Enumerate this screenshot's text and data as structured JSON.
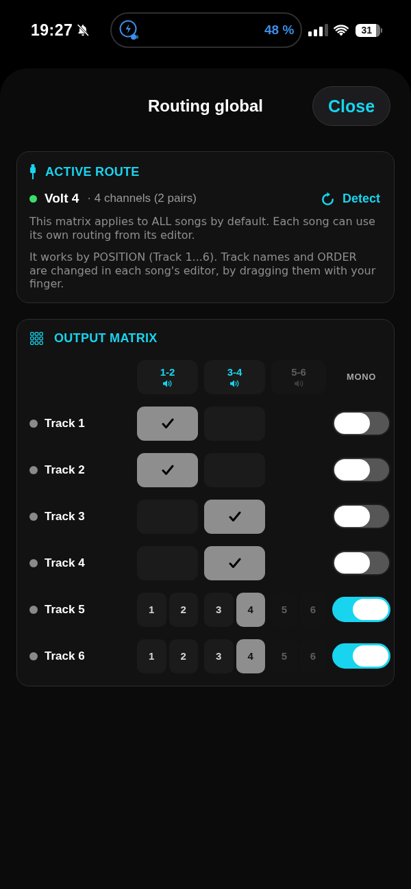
{
  "status_bar": {
    "time": "19:27",
    "charge_percent": "48 %",
    "battery": "31"
  },
  "sheet": {
    "title": "Routing global",
    "close_button": "Close"
  },
  "active_route": {
    "heading": "ACTIVE ROUTE",
    "device": {
      "name": "Volt 4",
      "detail": "· 4 channels (2 pairs)",
      "connected": true
    },
    "detect_button": "Detect",
    "paragraphs": [
      "This matrix applies to ALL songs by default. Each song can use its own routing from its editor.",
      "It works by POSITION (Track 1...6). Track names and ORDER are changed in each song's editor, by dragging them with your finger."
    ]
  },
  "output_matrix": {
    "heading": "OUTPUT MATRIX",
    "columns": [
      {
        "label": "1-2",
        "disabled": false
      },
      {
        "label": "3-4",
        "disabled": false
      },
      {
        "label": "5-6",
        "disabled": true
      }
    ],
    "mono_label": "MONO",
    "rows": [
      {
        "name": "Track 1",
        "kind": "pair",
        "pairs": [
          {
            "checked": true
          },
          {
            "checked": false
          }
        ],
        "mono": false
      },
      {
        "name": "Track 2",
        "kind": "pair",
        "pairs": [
          {
            "checked": true
          },
          {
            "checked": false
          }
        ],
        "mono": false
      },
      {
        "name": "Track 3",
        "kind": "pair",
        "pairs": [
          {
            "checked": false
          },
          {
            "checked": true
          }
        ],
        "mono": false
      },
      {
        "name": "Track 4",
        "kind": "pair",
        "pairs": [
          {
            "checked": false
          },
          {
            "checked": true
          }
        ],
        "mono": false
      },
      {
        "name": "Track 5",
        "kind": "channel",
        "channels": [
          {
            "label": "1",
            "selected": false,
            "disabled": false
          },
          {
            "label": "2",
            "selected": false,
            "disabled": false
          },
          {
            "label": "3",
            "selected": false,
            "disabled": false
          },
          {
            "label": "4",
            "selected": true,
            "disabled": false
          },
          {
            "label": "5",
            "selected": false,
            "disabled": true
          },
          {
            "label": "6",
            "selected": false,
            "disabled": true
          }
        ],
        "mono": true
      },
      {
        "name": "Track 6",
        "kind": "channel",
        "channels": [
          {
            "label": "1",
            "selected": false,
            "disabled": false
          },
          {
            "label": "2",
            "selected": false,
            "disabled": false
          },
          {
            "label": "3",
            "selected": false,
            "disabled": false
          },
          {
            "label": "4",
            "selected": true,
            "disabled": false
          },
          {
            "label": "5",
            "selected": false,
            "disabled": true
          },
          {
            "label": "6",
            "selected": false,
            "disabled": true
          }
        ],
        "mono": true
      }
    ]
  }
}
